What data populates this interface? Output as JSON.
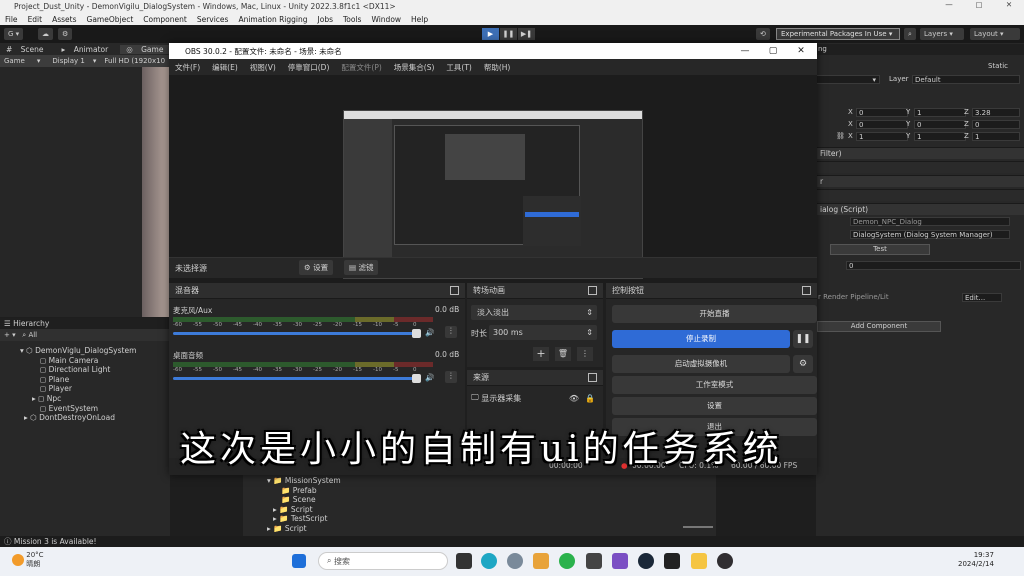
{
  "unity": {
    "title": "Project_Dust_Unity - DemonVigilu_DialogSystem - Windows, Mac, Linux - Unity 2022.3.8f1c1 <DX11>",
    "menu": [
      "File",
      "Edit",
      "Assets",
      "GameObject",
      "Component",
      "Services",
      "Animation Rigging",
      "Jobs",
      "Tools",
      "Window",
      "Help"
    ],
    "account_label": "G",
    "experimental": "Experimental Packages In Use ▾",
    "layers": "Layers",
    "layout": "Layout",
    "tabs": [
      "Scene",
      "Animator",
      "Game"
    ],
    "game_bar": [
      "Game",
      "Display 1",
      "Full HD (1920x10"
    ],
    "hierarchy": {
      "tab": "Hierarchy",
      "search_placeholder": "All",
      "scene": "DemonViglu_DialogSystem",
      "items": [
        "Main Camera",
        "Directional Light",
        "Plane",
        "Player",
        "Npc",
        "EventSystem"
      ],
      "dont_destroy": "DontDestroyOnLoad"
    },
    "inspector": {
      "tab": "ng",
      "static": "Static",
      "layer_label": "Layer",
      "layer_value": "Default",
      "rows": [
        {
          "x": "0",
          "y": "1",
          "z": "3.28"
        },
        {
          "x": "0",
          "y": "0",
          "z": "0"
        },
        {
          "x": "1",
          "y": "1",
          "z": "1"
        }
      ],
      "filter": "Filter)",
      "r_label": "r",
      "dialog_script": "ialog (Script)",
      "npc_dialog": "Demon_NPC_Dialog",
      "dialog_system": "DialogSystem (Dialog System Manager)",
      "test_button": "Test",
      "zero_field": "0",
      "pipeline": "r Render Pipeline/Lit",
      "edit": "Edit...",
      "add_component": "Add Component"
    },
    "project": {
      "items": [
        "MissionSystem",
        "Prefab",
        "Scene",
        "Script",
        "TestScript",
        "Script"
      ]
    },
    "status": "Mission 3 is Available!"
  },
  "obs": {
    "title": "OBS 30.0.2 - 配置文件: 未命名 - 场景: 未命名",
    "menu": [
      "文件(F)",
      "编辑(E)",
      "视图(V)",
      "停靠窗口(D)",
      "配置文件(P)",
      "场景集合(S)",
      "工具(T)",
      "帮助(H)"
    ],
    "no_source": "未选择源",
    "settings_btn": "设置",
    "filters_btn": "滤镜",
    "mixer": {
      "title": "混音器",
      "channels": [
        {
          "name": "麦克风/Aux",
          "db": "0.0 dB"
        },
        {
          "name": "桌面音频",
          "db": "0.0 dB"
        }
      ],
      "scale": [
        "-60",
        "-55",
        "-50",
        "-45",
        "-40",
        "-35",
        "-30",
        "-25",
        "-20",
        "-15",
        "-10",
        "-5",
        "0"
      ]
    },
    "transitions": {
      "title": "转场动画",
      "type": "淡入淡出",
      "duration_label": "时长",
      "duration": "300 ms"
    },
    "sources": {
      "title": "来源",
      "item": "显示器采集"
    },
    "controls": {
      "title": "控制按钮",
      "start_stream": "开始直播",
      "stop_record": "停止录制",
      "virtual_cam": "启动虚拟摄像机",
      "studio_mode": "工作室模式",
      "settings": "设置",
      "exit": "退出"
    },
    "status": {
      "stream_time": "00:00:00",
      "rec_time": "00:00:00",
      "cpu": "CPU: 0.1%",
      "fps": "60.00 / 60.00 FPS"
    }
  },
  "subtitle": "这次是小小的自制有ui的任务系统",
  "taskbar": {
    "temp": "20°C",
    "weather": "晴朗",
    "search_placeholder": "搜索",
    "time": "19:37",
    "date": "2024/2/14"
  },
  "colors": {
    "accent_blue": "#3d6fb5",
    "obs_record_blue": "#2f6bd6",
    "unity_bg": "#282828"
  }
}
